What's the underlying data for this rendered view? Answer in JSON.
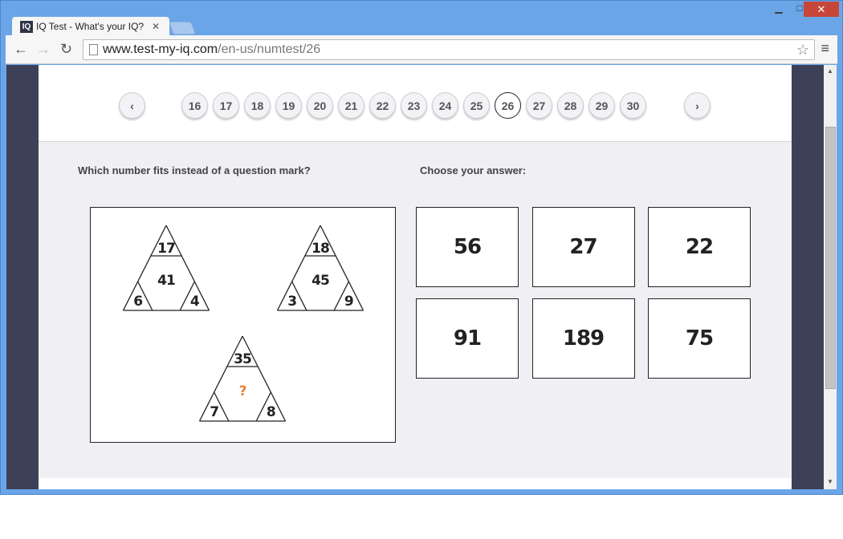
{
  "browser": {
    "tab_title": "IQ Test - What's your IQ?",
    "favicon": "IQ",
    "url_host": "www.test-my-iq.com",
    "url_path": "/en-us/numtest/26"
  },
  "pager": {
    "pages": [
      "16",
      "17",
      "18",
      "19",
      "20",
      "21",
      "22",
      "23",
      "24",
      "25",
      "26",
      "27",
      "28",
      "29",
      "30"
    ],
    "current": "26",
    "prev": "‹",
    "next": "›"
  },
  "question": "Which number fits instead of a question mark?",
  "answer_prompt": "Choose your answer:",
  "puzzle": {
    "triangles": [
      {
        "top": "17",
        "center": "41",
        "left": "6",
        "right": "4"
      },
      {
        "top": "18",
        "center": "45",
        "left": "3",
        "right": "9"
      },
      {
        "top": "35",
        "center": "?",
        "left": "7",
        "right": "8"
      }
    ],
    "question_color": "#e8833a"
  },
  "answers": [
    "56",
    "27",
    "22",
    "91",
    "189",
    "75"
  ]
}
